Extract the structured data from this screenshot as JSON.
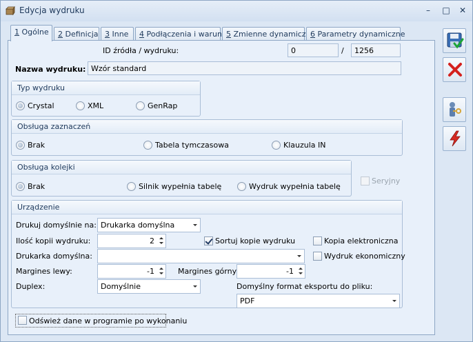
{
  "window": {
    "title": "Edycja wydruku",
    "minimize": "–",
    "maximize": "□",
    "close": "✕"
  },
  "tabs": [
    {
      "num": "1",
      "label": " Ogólne"
    },
    {
      "num": "2",
      "label": " Definicja"
    },
    {
      "num": "3",
      "label": " Inne"
    },
    {
      "num": "4",
      "label": " Podłączenia i warunki"
    },
    {
      "num": "5",
      "label": " Zmienne dynamiczne"
    },
    {
      "num": "6",
      "label": " Parametry dynamiczne"
    }
  ],
  "general": {
    "id_label": "ID źródła / wydruku:",
    "id_source": "0",
    "id_sep": "/",
    "id_print": "1256",
    "name_label": "Nazwa wydruku:",
    "name_value": "Wzór standard"
  },
  "typ_wydruku": {
    "title": "Typ wydruku",
    "options": [
      "Crystal",
      "XML",
      "GenRap"
    ],
    "selected": "Crystal"
  },
  "obsluga_zaznaczen": {
    "title": "Obsługa zaznaczeń",
    "options": [
      "Brak",
      "Tabela tymczasowa",
      "Klauzula IN"
    ],
    "selected": "Brak"
  },
  "obsluga_kolejki": {
    "title": "Obsługa kolejki",
    "options": [
      "Brak",
      "Silnik wypełnia tabelę",
      "Wydruk wypełnia tabelę"
    ],
    "selected": "Brak",
    "seryjny_label": "Seryjny"
  },
  "urzadzenie": {
    "title": "Urządzenie",
    "drukuj_label": "Drukuj domyślnie na:",
    "drukuj_value": "Drukarka domyślna",
    "ilosc_label": "Ilość kopii wydruku:",
    "ilosc_value": "2",
    "sortuj_label": "Sortuj kopie wydruku",
    "kopia_label": "Kopia elektroniczna",
    "drukarka_label": "Drukarka domyślna:",
    "drukarka_value": "",
    "ekonomiczny_label": "Wydruk ekonomiczny",
    "margines_lewy_label": "Margines lewy:",
    "margines_lewy_value": "-1",
    "margines_gorny_label": "Margines górny:",
    "margines_gorny_value": "-1",
    "duplex_label": "Duplex:",
    "duplex_value": "Domyślnie",
    "format_label": "Domyślny format eksportu do pliku:",
    "format_value": "PDF"
  },
  "odswiez_label": "Odśwież dane w programie po wykonaniu",
  "colors": {
    "accent": "#1e395b",
    "border": "#8da6c4",
    "panel": "#e8f0fa"
  },
  "side_icons": [
    "save-icon",
    "cancel-icon",
    "user-key-icon",
    "lightning-icon"
  ]
}
